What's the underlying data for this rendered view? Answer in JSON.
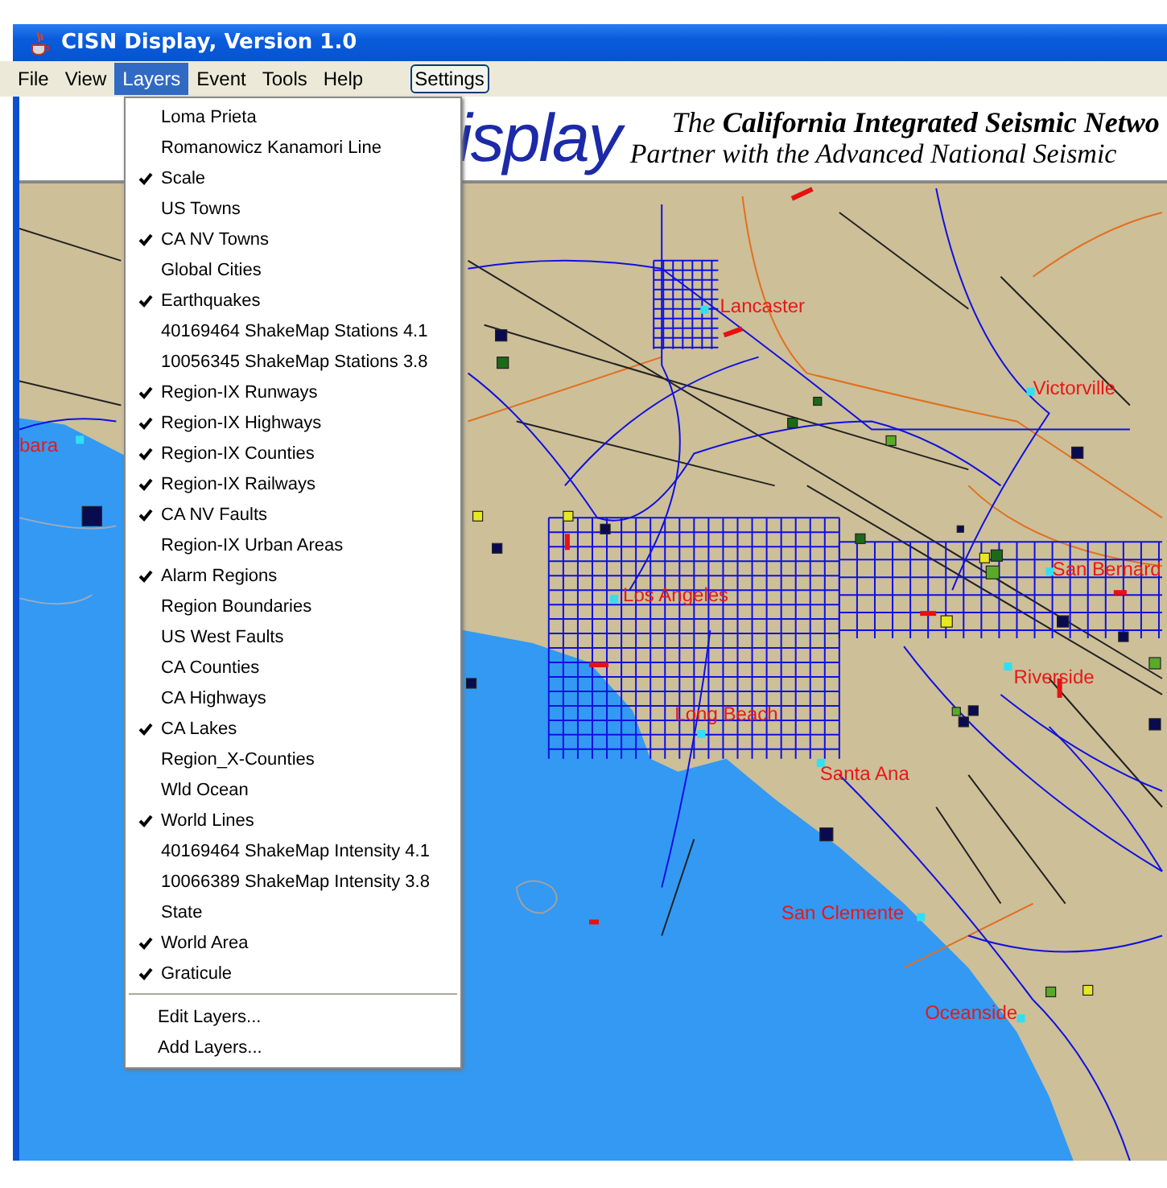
{
  "window": {
    "title": "CISN Display, Version 1.0"
  },
  "menus": [
    {
      "label": "File",
      "selected": false
    },
    {
      "label": "View",
      "selected": false
    },
    {
      "label": "Layers",
      "selected": true
    },
    {
      "label": "Event",
      "selected": false
    },
    {
      "label": "Tools",
      "selected": false
    },
    {
      "label": "Help",
      "selected": false
    }
  ],
  "settings_button": "Settings",
  "banner": {
    "logo_text": "isplay",
    "line_1": "The **California Integrated Seismic Netwo**",
    "line_2": "Partner with the Advanced National Seismic"
  },
  "layers_menu": {
    "layers": [
      {
        "label": "Loma Prieta",
        "checked": false
      },
      {
        "label": "Romanowicz Kanamori Line",
        "checked": false
      },
      {
        "label": "Scale",
        "checked": true
      },
      {
        "label": "US Towns",
        "checked": false
      },
      {
        "label": "CA NV Towns",
        "checked": true
      },
      {
        "label": "Global Cities",
        "checked": false
      },
      {
        "label": "Earthquakes",
        "checked": true
      },
      {
        "label": "40169464 ShakeMap Stations 4.1",
        "checked": false
      },
      {
        "label": "10056345 ShakeMap Stations 3.8",
        "checked": false
      },
      {
        "label": "Region-IX Runways",
        "checked": true
      },
      {
        "label": "Region-IX Highways",
        "checked": true
      },
      {
        "label": "Region-IX Counties",
        "checked": true
      },
      {
        "label": "Region-IX Railways",
        "checked": true
      },
      {
        "label": "CA NV Faults",
        "checked": true
      },
      {
        "label": "Region-IX Urban Areas",
        "checked": false
      },
      {
        "label": "Alarm Regions",
        "checked": true
      },
      {
        "label": "Region Boundaries",
        "checked": false
      },
      {
        "label": "US West Faults",
        "checked": false
      },
      {
        "label": "CA Counties",
        "checked": false
      },
      {
        "label": "CA Highways",
        "checked": false
      },
      {
        "label": "CA Lakes",
        "checked": true
      },
      {
        "label": "Region_X-Counties",
        "checked": false
      },
      {
        "label": "Wld Ocean",
        "checked": false
      },
      {
        "label": "World Lines",
        "checked": true
      },
      {
        "label": "40169464 ShakeMap Intensity 4.1",
        "checked": false
      },
      {
        "label": "10066389 ShakeMap Intensity 3.8",
        "checked": false
      },
      {
        "label": "State",
        "checked": false
      },
      {
        "label": "World Area",
        "checked": true
      },
      {
        "label": "Graticule",
        "checked": true
      }
    ],
    "actions": [
      "Edit Layers...",
      "Add Layers..."
    ]
  },
  "map": {
    "towns": [
      {
        "label": "Lancaster"
      },
      {
        "label": "Victorville"
      },
      {
        "label": "bara"
      },
      {
        "label": "San Bernard"
      },
      {
        "label": "Los Angeles"
      },
      {
        "label": "Riverside"
      },
      {
        "label": "Long Beach"
      },
      {
        "label": "Santa Ana"
      },
      {
        "label": "San Clemente"
      },
      {
        "label": "Oceanside"
      }
    ]
  }
}
